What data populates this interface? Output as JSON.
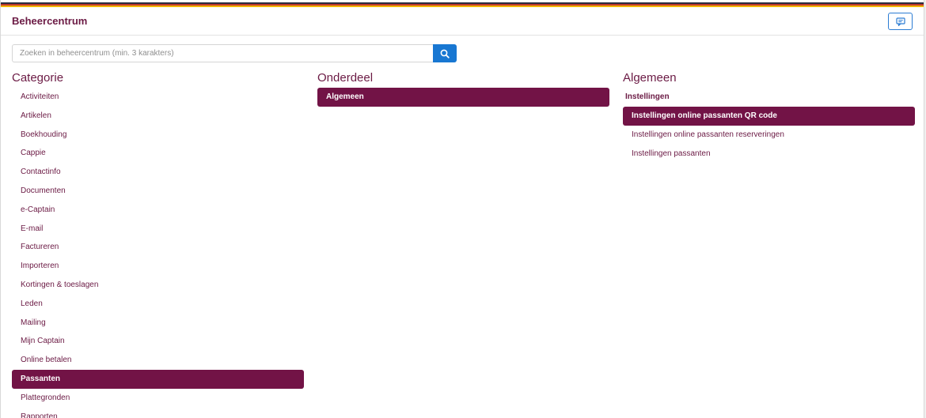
{
  "header": {
    "title": "Beheercentrum",
    "feedback_icon": "chat-icon"
  },
  "search": {
    "placeholder": "Zoeken in beheercentrum (min. 3 karakters)",
    "value": "",
    "button_icon": "search-icon"
  },
  "columns": {
    "categorie": {
      "heading": "Categorie",
      "items": [
        {
          "label": "Activiteiten"
        },
        {
          "label": "Artikelen"
        },
        {
          "label": "Boekhouding"
        },
        {
          "label": "Cappie"
        },
        {
          "label": "Contactinfo"
        },
        {
          "label": "Documenten"
        },
        {
          "label": "e-Captain"
        },
        {
          "label": "E-mail"
        },
        {
          "label": "Factureren"
        },
        {
          "label": "Importeren"
        },
        {
          "label": "Kortingen & toeslagen"
        },
        {
          "label": "Leden"
        },
        {
          "label": "Mailing"
        },
        {
          "label": "Mijn Captain"
        },
        {
          "label": "Online betalen"
        },
        {
          "label": "Passanten",
          "active": true
        },
        {
          "label": "Plattegronden"
        },
        {
          "label": "Rapporten"
        }
      ]
    },
    "onderdeel": {
      "heading": "Onderdeel",
      "items": [
        {
          "label": "Algemeen",
          "active": true
        }
      ]
    },
    "algemeen": {
      "heading": "Algemeen",
      "group_label": "Instellingen",
      "items": [
        {
          "label": "Instellingen online passanten QR code",
          "active": true
        },
        {
          "label": "Instellingen online passanten reserveringen"
        },
        {
          "label": "Instellingen passanten"
        }
      ]
    }
  },
  "colors": {
    "brand": "#6b1a44",
    "active_bg": "#721346",
    "accent_blue": "#1877d2"
  }
}
